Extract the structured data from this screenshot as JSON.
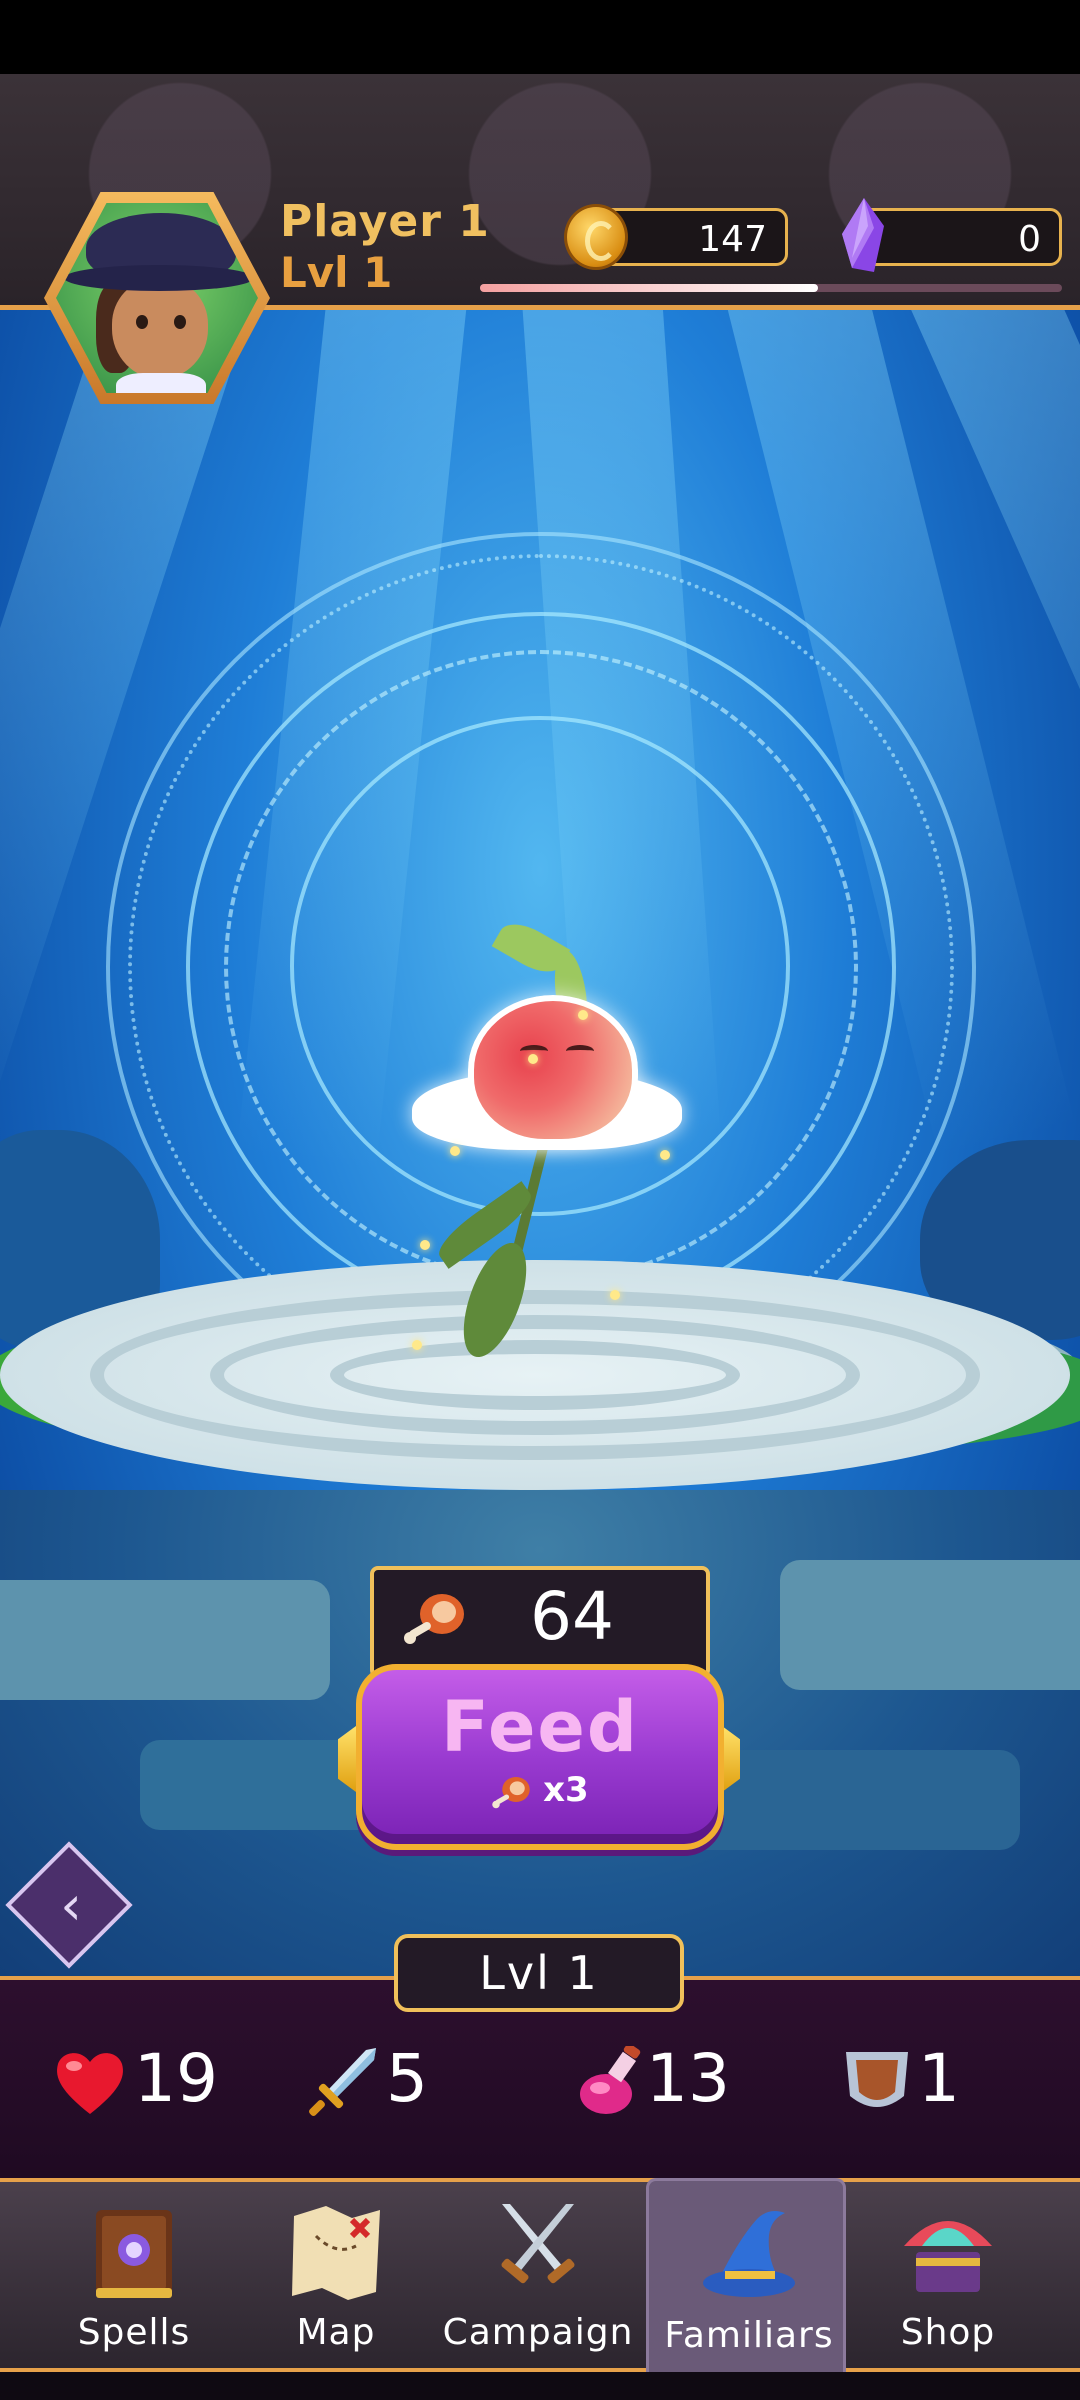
{
  "header": {
    "player_name": "Player 1",
    "player_level": "Lvl 1",
    "coins": "147",
    "gems": "0",
    "xp_progress": 0.58
  },
  "familiar": {
    "food_count": "64",
    "feed_label": "Feed",
    "feed_cost": "x3",
    "level": "Lvl 1"
  },
  "stats": {
    "health": "19",
    "attack": "5",
    "magic": "13",
    "defense": "1"
  },
  "nav": {
    "items": [
      {
        "label": "Spells",
        "icon": "spellbook-icon"
      },
      {
        "label": "Map",
        "icon": "treasure-map-icon"
      },
      {
        "label": "Campaign",
        "icon": "crossed-swords-icon"
      },
      {
        "label": "Familiars",
        "icon": "wizard-hat-icon"
      },
      {
        "label": "Shop",
        "icon": "treasure-chest-icon"
      }
    ],
    "active": "Familiars"
  },
  "colors": {
    "accent_gold": "#e6a14a",
    "feed_button": "#9a3bd1",
    "panel_dark": "#231a26"
  }
}
